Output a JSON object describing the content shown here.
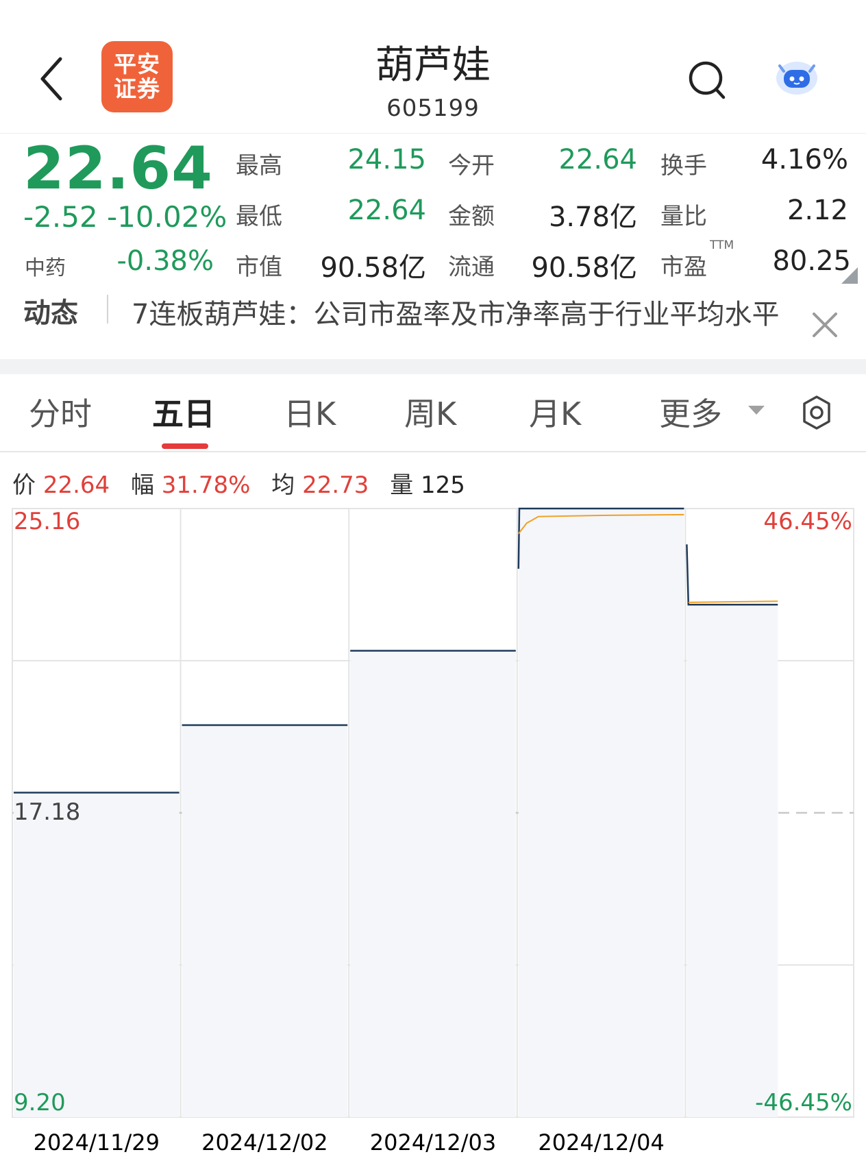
{
  "header": {
    "broker_logo_line1": "平安",
    "broker_logo_line2": "证券",
    "stock_name": "葫芦娃",
    "stock_code": "605199",
    "icons": [
      "chevron-left-icon",
      "search-icon",
      "robot-assistant-icon"
    ]
  },
  "quote": {
    "price": "22.64",
    "change": "-2.52",
    "change_pct": "-10.02%",
    "sector_name": "中药",
    "sector_change": "-0.38%",
    "fields": [
      {
        "label": "最高",
        "value": "24.15"
      },
      {
        "label": "今开",
        "value": "22.64"
      },
      {
        "label": "换手",
        "value": "4.16%"
      },
      {
        "label": "最低",
        "value": "22.64"
      },
      {
        "label": "金额",
        "value": "3.78亿"
      },
      {
        "label": "量比",
        "value": "2.12"
      },
      {
        "label": "市值",
        "value": "90.58亿"
      },
      {
        "label": "流通",
        "value": "90.58亿"
      },
      {
        "label": "市盈",
        "value": "80.25"
      }
    ],
    "ttm_label": "TTM",
    "colors": {
      "down": "#1f9a5b",
      "up": "#e0403a"
    }
  },
  "news": {
    "tag": "动态",
    "text": "7连板葫芦娃：公司市盈率及市净率高于行业平均水平",
    "close_icon": "close-icon"
  },
  "tabs": [
    {
      "label": "分时",
      "active": false
    },
    {
      "label": "五日",
      "active": true
    },
    {
      "label": "日K",
      "active": false
    },
    {
      "label": "周K",
      "active": false
    },
    {
      "label": "月K",
      "active": false
    },
    {
      "label": "更多",
      "active": false
    }
  ],
  "settings_icon": "gear-icon",
  "info_line": {
    "price_label": "价",
    "price": "22.64",
    "amp_label": "幅",
    "amp": "31.78%",
    "avg_label": "均",
    "avg": "22.73",
    "vol_label": "量",
    "vol": "125"
  },
  "chart_data": {
    "type": "line",
    "title": "",
    "y_left_ticks": [
      "25.16",
      "17.18",
      "9.20"
    ],
    "y_right_ticks": [
      "46.45%",
      "-46.45%"
    ],
    "ylim": [
      9.2,
      25.16
    ],
    "pre_close": 17.18,
    "x_labels": [
      "2024/11/29",
      "2024/12/02",
      "2024/12/03",
      "2024/12/04"
    ],
    "days": 5,
    "series": [
      {
        "name": "价",
        "color": "#1f3a5a",
        "days": [
          [
            [
              0,
              17.71
            ],
            [
              1,
              17.71
            ]
          ],
          [
            [
              0,
              19.48
            ],
            [
              1,
              19.48
            ]
          ],
          [
            [
              0,
              21.43
            ],
            [
              1,
              21.43
            ]
          ],
          [
            [
              0,
              23.58
            ],
            [
              0.005,
              25.16
            ],
            [
              1,
              25.16
            ]
          ],
          [
            [
              0,
              24.22
            ],
            [
              0.01,
              22.64
            ],
            [
              0.55,
              22.64
            ]
          ]
        ]
      },
      {
        "name": "均",
        "color": "#f0a020",
        "days": [
          null,
          null,
          null,
          [
            [
              0,
              24.5
            ],
            [
              0.05,
              24.78
            ],
            [
              0.08,
              24.85
            ],
            [
              0.12,
              24.95
            ],
            [
              0.5,
              24.98
            ],
            [
              1,
              25.0
            ]
          ],
          [
            [
              0.01,
              22.7
            ],
            [
              0.55,
              22.73
            ]
          ]
        ]
      }
    ]
  }
}
